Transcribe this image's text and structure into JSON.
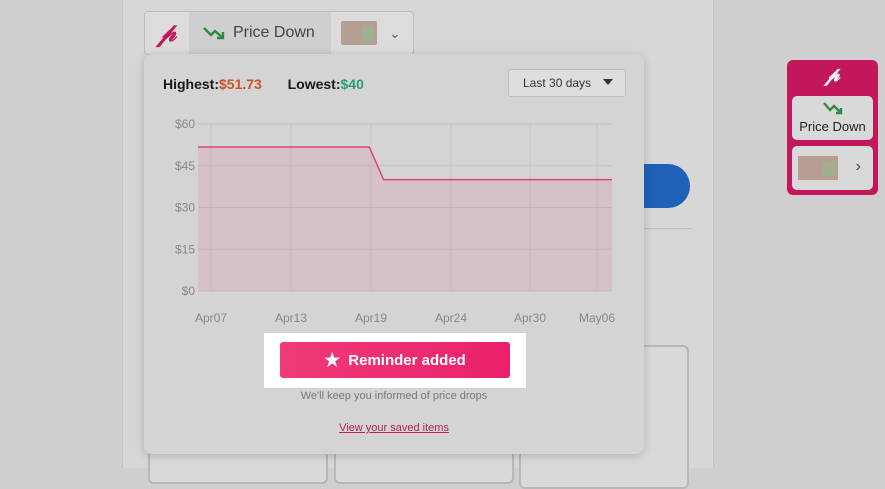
{
  "toolbar": {
    "logo_icon": "pricepulse-p-logo-icon",
    "price_status_label": "Price Down",
    "price_status_icon": "trend-down-arrow-icon",
    "product_thumb_icon": "product-thumbnail-icon",
    "menu_icon": "chevron-down-icon"
  },
  "popup": {
    "highest_label": "Highest:",
    "highest_value": "$51.73",
    "lowest_label": "Lowest:",
    "lowest_value": "$40",
    "range_selected": "Last 30 days",
    "reminder_button_label": "Reminder added",
    "reminder_icon": "star-icon",
    "info_text": "We'll keep you informed of price drops",
    "saved_link": "View your saved items"
  },
  "widget": {
    "logo_icon": "pricepulse-p-logo-icon",
    "price_status_label": "Price Down",
    "price_status_icon": "trend-down-arrow-icon",
    "product_thumb_icon": "product-thumbnail-icon",
    "open_icon": "chevron-right-icon"
  },
  "colors": {
    "brand": "#c2185b",
    "highest": "#c9522a",
    "lowest": "#2a9d78",
    "line": "#e0457a",
    "button": "#ef3b7a"
  },
  "chart_data": {
    "type": "line",
    "x_tick_labels": [
      "Apr07",
      "Apr13",
      "Apr19",
      "Apr24",
      "Apr30",
      "May06"
    ],
    "y_tick_labels": [
      "$60",
      "$45",
      "$30",
      "$15",
      "$0"
    ],
    "ylim": [
      0,
      60
    ],
    "grid": true,
    "series": [
      {
        "x": [
          "Apr07",
          "Apr19",
          "Apr20",
          "May06"
        ],
        "values": [
          51.73,
          51.73,
          40,
          40
        ]
      }
    ]
  }
}
